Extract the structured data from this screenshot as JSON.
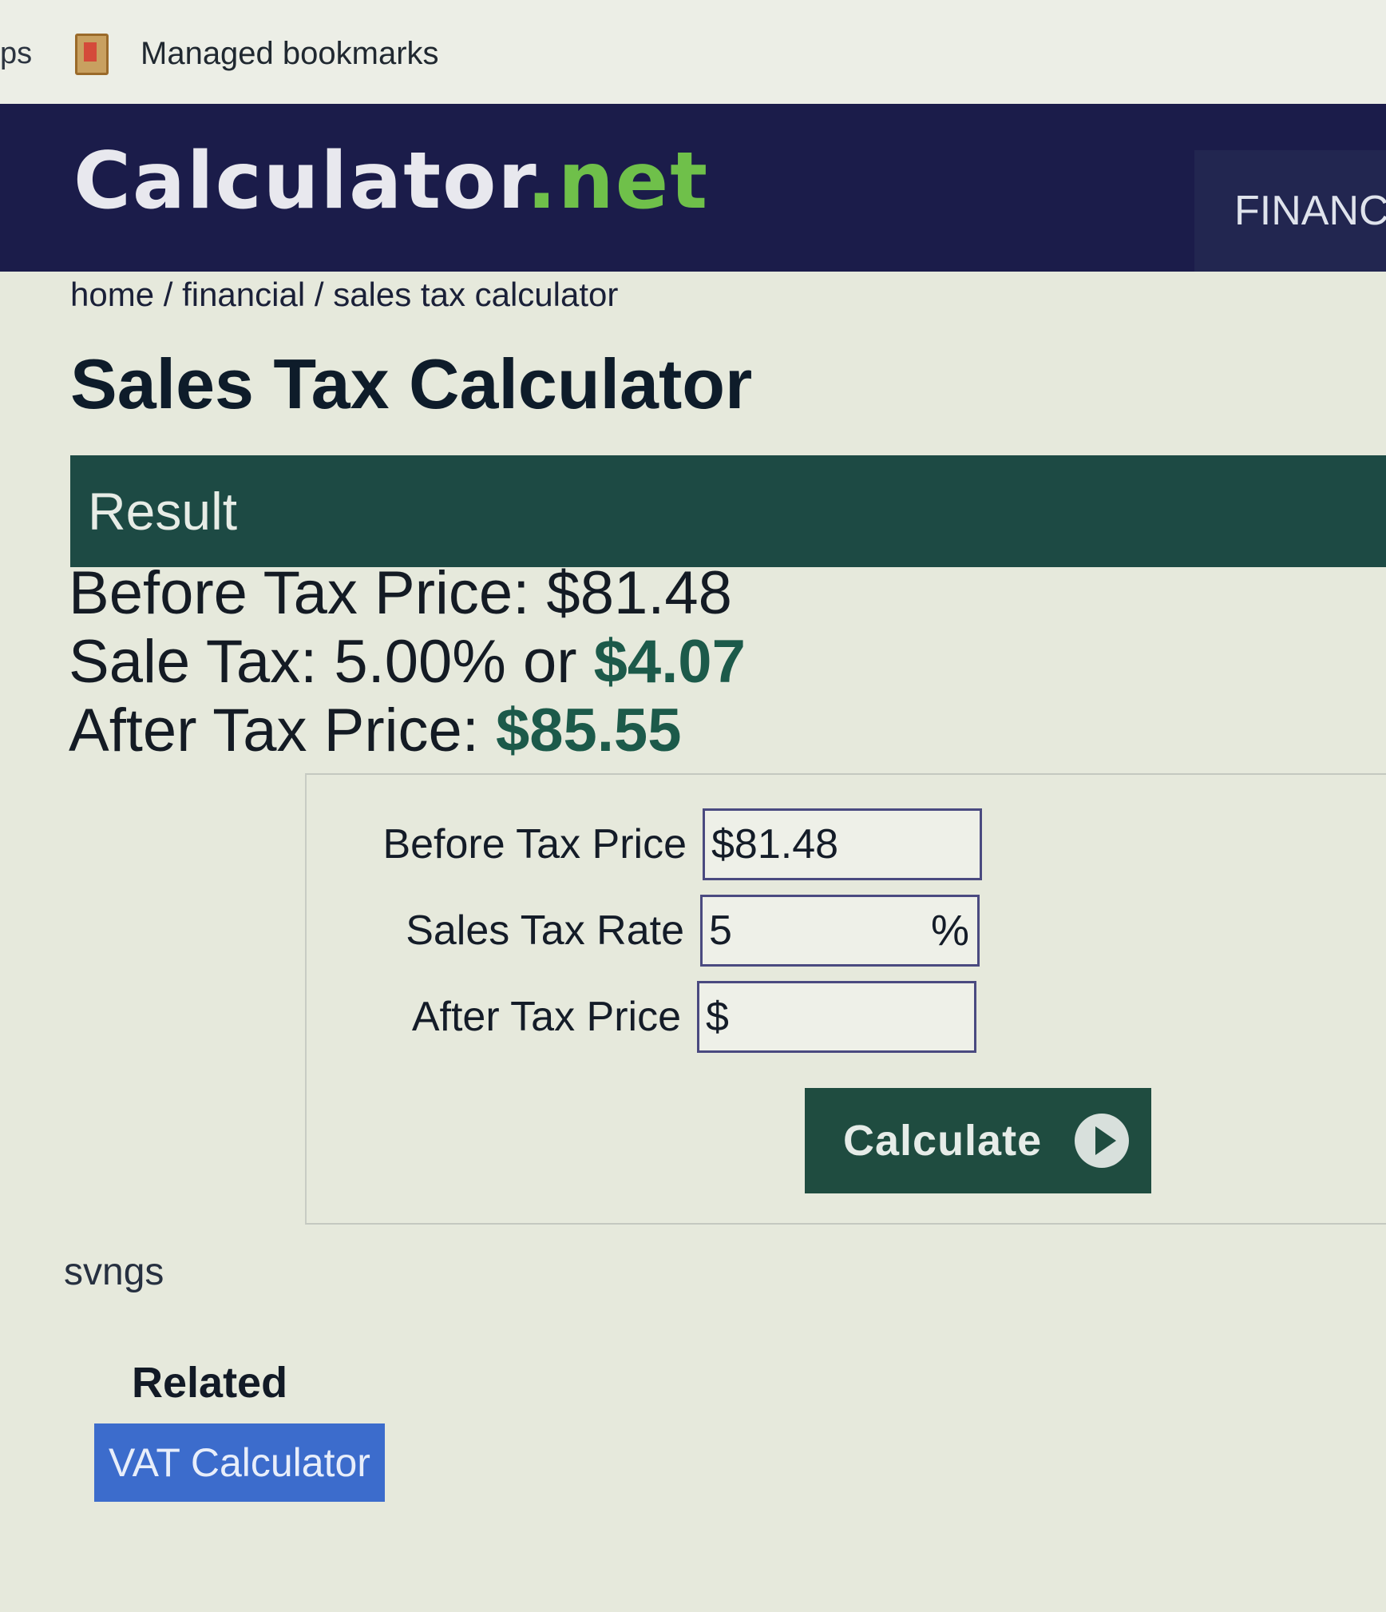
{
  "bookmarks_bar": {
    "apps_label": "ps",
    "folder_label": "Managed bookmarks"
  },
  "header": {
    "logo_main": "Calculator",
    "logo_dot": ".",
    "logo_net": "net",
    "nav_tab": "FINANC"
  },
  "breadcrumb": {
    "home": "home",
    "sep1": " / ",
    "financial": "financial",
    "sep2": " / ",
    "current": "sales tax calculator"
  },
  "page_title": "Sales Tax Calculator",
  "result": {
    "heading": "Result",
    "line1_label": "Before Tax Price: $81.48",
    "line2_label": "Sale Tax: 5.00% or ",
    "line2_value": "$4.07",
    "line3_label": "After Tax Price: ",
    "line3_value": "$85.55"
  },
  "form": {
    "before_tax_label": "Before Tax Price",
    "before_tax_value": "$81.48",
    "rate_label": "Sales Tax Rate",
    "rate_value": "5",
    "rate_unit": "%",
    "after_tax_label": "After Tax Price",
    "after_tax_value": "$",
    "calculate_label": "Calculate"
  },
  "misc_text": "svngs",
  "related": {
    "title": "Related",
    "links": [
      "VAT Calculator"
    ]
  },
  "colors": {
    "header_bg": "#1b1c4a",
    "accent_green": "#1d4a44",
    "logo_green": "#6fc04a",
    "link_blue": "#3c6ccc"
  }
}
